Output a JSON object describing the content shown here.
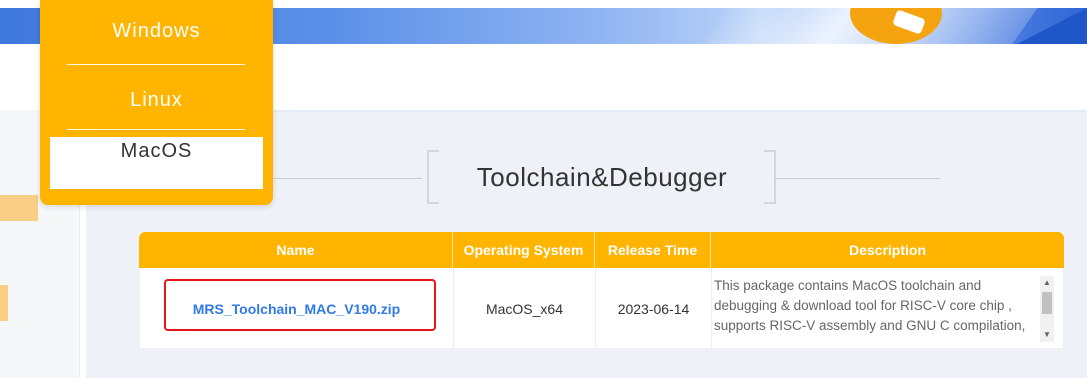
{
  "os_menu": {
    "items": [
      {
        "label": "Windows",
        "selected": false
      },
      {
        "label": "Linux",
        "selected": false
      },
      {
        "label": "MacOS",
        "selected": true
      }
    ]
  },
  "section": {
    "title": "Toolchain&Debugger"
  },
  "downloads_table": {
    "columns": [
      "Name",
      "Operating System",
      "Release Time",
      "Description"
    ],
    "rows": [
      {
        "name": "MRS_Toolchain_MAC_V190.zip",
        "operating_system": "MacOS_x64",
        "release_time": "2023-06-14",
        "description": "This package contains MacOS toolchain and debugging & download tool for RISC-V core chip , supports RISC-V assembly and GNU C compilation,"
      }
    ]
  },
  "colors": {
    "accent": "#ffb400",
    "link": "#2f7ae5",
    "highlight": "#e4151d",
    "banner": "#3f78de"
  }
}
